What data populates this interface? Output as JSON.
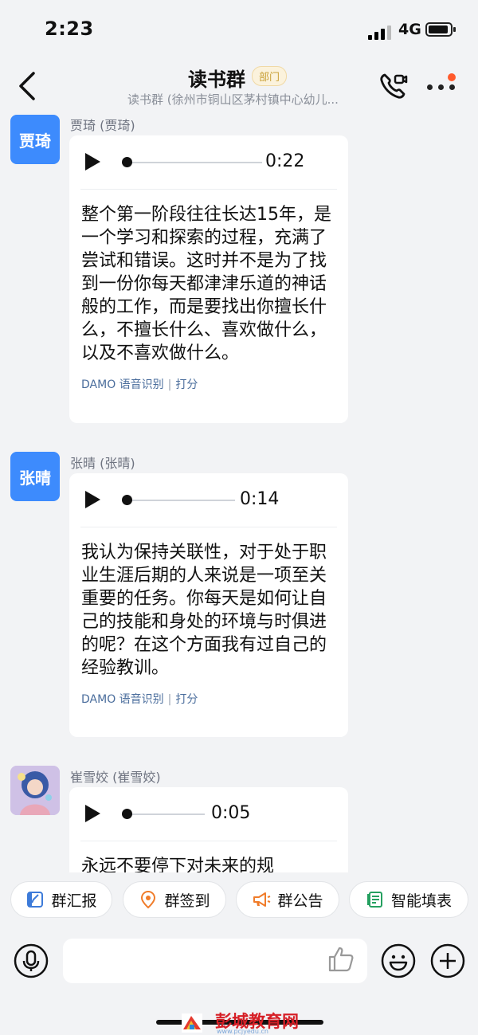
{
  "status_bar": {
    "time": "2:23",
    "network": "4G"
  },
  "header": {
    "title": "读书群",
    "badge": "部门",
    "subtitle": "读书群 (徐州市铜山区茅村镇中心幼儿..."
  },
  "messages": [
    {
      "avatar_text": "贾琦",
      "sender": "贾琦 (贾琦)",
      "duration": "0:22",
      "transcript": "整个第一阶段往往长达15年，是一个学习和探索的过程，充满了尝试和错误。这时并不是为了找到一份你每天都津津乐道的神话般的工作，而是要找出你擅长什么，不擅长什么、喜欢做什么，以及不喜欢做什么。",
      "asr_label": "DAMO 语音识别",
      "sep": "|",
      "rate_label": "打分"
    },
    {
      "avatar_text": "张晴",
      "sender": "张晴 (张晴)",
      "duration": "0:14",
      "transcript": "我认为保持关联性，对于处于职业生涯后期的人来说是一项至关重要的任务。你每天是如何让自己的技能和身处的环境与时俱进的呢？在这个方面我有过自己的经验教训。",
      "asr_label": "DAMO 语音识别",
      "sep": "|",
      "rate_label": "打分"
    },
    {
      "avatar_text": "",
      "sender": "崔雪姣 (崔雪姣)",
      "duration": "0:05",
      "transcript": "永远不要停下对未来的规",
      "asr_label": "",
      "sep": "",
      "rate_label": ""
    }
  ],
  "quick_actions": [
    "群汇报",
    "群签到",
    "群公告",
    "智能填表"
  ],
  "watermark": {
    "text": "彭城教育网",
    "sub": "www.pcjyedu.cn"
  },
  "colors": {
    "avatar_blue": "#3d8bfd",
    "badge_gold": "#c9a037",
    "accent_red": "#ff5a2c",
    "link_blue": "#4a6d9c"
  }
}
